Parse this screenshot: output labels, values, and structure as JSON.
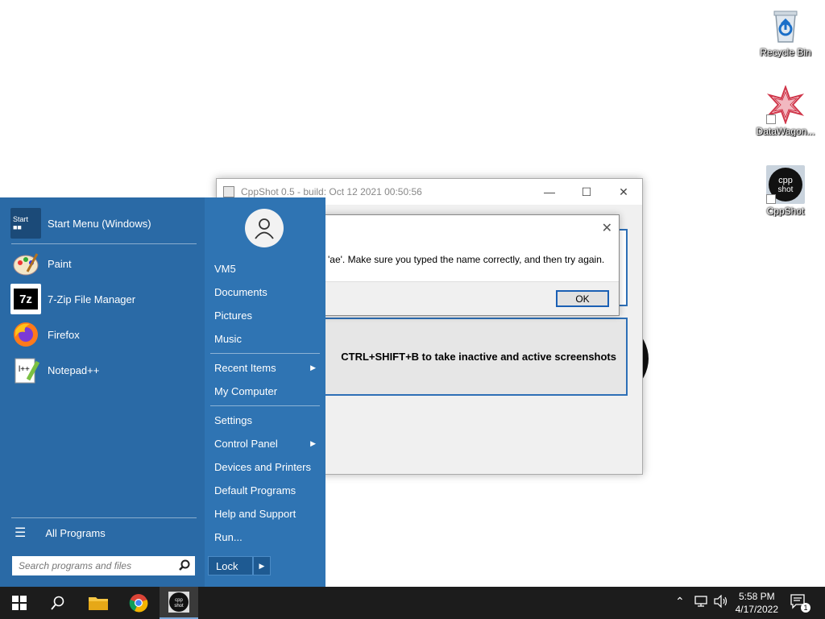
{
  "desktop": {
    "icons": [
      {
        "label": "Recycle Bin"
      },
      {
        "label": "DataWagon..."
      },
      {
        "label": "CppShot"
      }
    ]
  },
  "cppshot_window": {
    "title": "CppShot 0.5 - build: Oct 12 2021 00:50:56",
    "instruction": "CTRL+SHIFT+B to take inactive and active screenshots"
  },
  "error_dialog": {
    "message": "'ae'. Make sure you typed the name correctly, and then try again.",
    "ok_label": "OK"
  },
  "start_menu": {
    "pinned": [
      {
        "label": "Start Menu (Windows)"
      },
      {
        "label": "Paint"
      },
      {
        "label": "7-Zip File Manager"
      },
      {
        "label": "Firefox"
      },
      {
        "label": "Notepad++"
      }
    ],
    "all_programs": "All Programs",
    "search_placeholder": "Search programs and files",
    "right_items": [
      {
        "label": "VM5"
      },
      {
        "label": "Documents"
      },
      {
        "label": "Pictures"
      },
      {
        "label": "Music"
      },
      {
        "label": "Recent Items"
      },
      {
        "label": "My Computer"
      },
      {
        "label": "Settings"
      },
      {
        "label": "Control Panel"
      },
      {
        "label": "Devices and Printers"
      },
      {
        "label": "Default Programs"
      },
      {
        "label": "Help and Support"
      },
      {
        "label": "Run..."
      }
    ],
    "lock_label": "Lock"
  },
  "taskbar": {
    "time": "5:58 PM",
    "date": "4/17/2022",
    "notification_count": "1"
  }
}
